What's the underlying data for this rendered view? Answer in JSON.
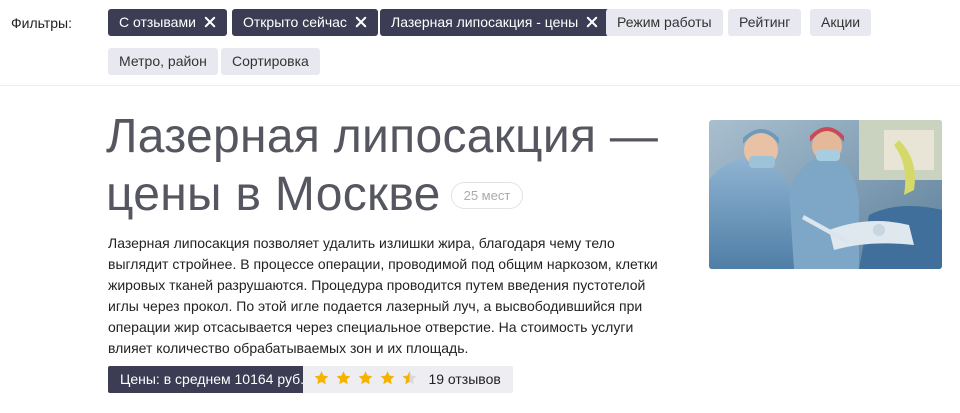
{
  "filters": {
    "label": "Фильтры:",
    "chips": [
      {
        "label": "С отзывами",
        "active": true
      },
      {
        "label": "Открыто сейчас",
        "active": true
      },
      {
        "label": "Лазерная липосакция - цены",
        "active": true
      },
      {
        "label": "Режим работы",
        "active": false
      },
      {
        "label": "Рейтинг",
        "active": false
      },
      {
        "label": "Акции",
        "active": false
      },
      {
        "label": "Метро, район",
        "active": false
      },
      {
        "label": "Сортировка",
        "active": false
      }
    ]
  },
  "page": {
    "title_line1": "Лазерная липосакция —",
    "title_line2": "цены в Москве",
    "places_count": "25 мест",
    "description": "Лазерная липосакция позволяет удалить излишки жира, благодаря чему тело выглядит стройнее. В процессе операции, проводимой под общим наркозом, клетки жировых тканей разрушаются. Процедура проводится путем введения пустотелой иглы через прокол. По этой игле подается лазерный луч, а высвободившийся при операции жир отсасывается через специальное отверстие. На стоимость услуги влияет количество обрабатываемых зон и их площадь.",
    "price": "Цены: в среднем 10164 руб.",
    "rating": {
      "value": 4.5,
      "max": 5,
      "reviews": "19 отзывов"
    }
  },
  "colors": {
    "active_chip": "#3c3d55",
    "inactive_chip": "#e8e9f0",
    "star": "#f5b301",
    "title": "#555660"
  }
}
